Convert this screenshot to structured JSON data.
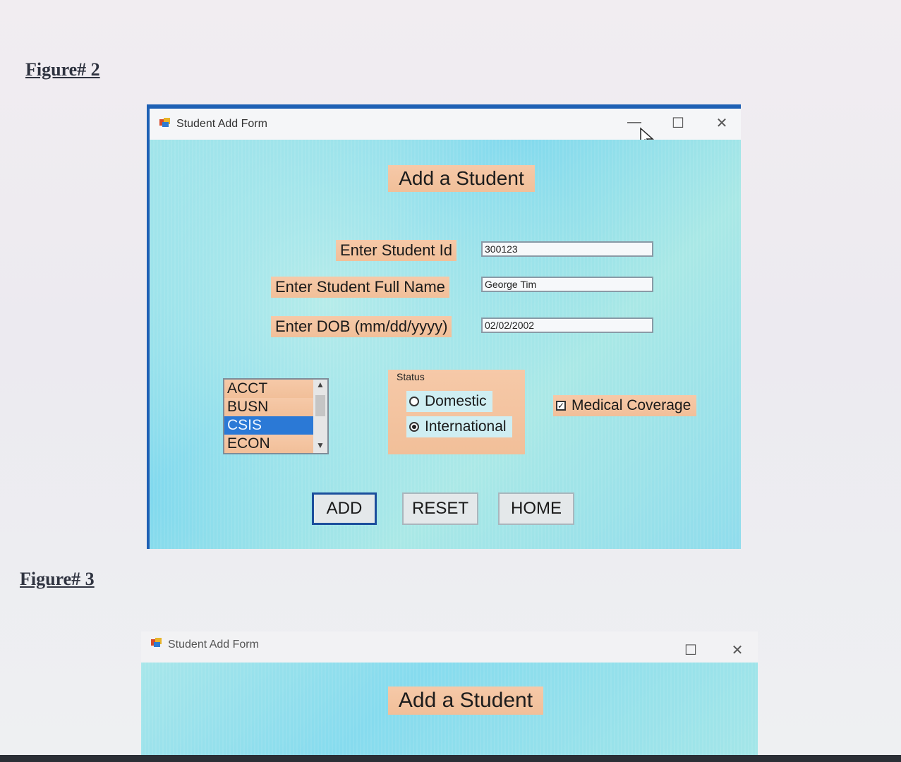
{
  "figures": {
    "fig2_label": "Figure# 2",
    "fig3_label": "Figure# 3"
  },
  "window": {
    "title": "Student Add Form",
    "controls": {
      "minimize": "—",
      "maximize": "☐",
      "close": "✕"
    }
  },
  "form": {
    "heading": "Add a Student",
    "student_id": {
      "label": "Enter Student Id",
      "value": "300123"
    },
    "full_name": {
      "label": "Enter Student Full Name",
      "value": "George Tim"
    },
    "dob": {
      "label": "Enter DOB (mm/dd/yyyy)",
      "value": "02/02/2002"
    },
    "departments": {
      "items": [
        "ACCT",
        "BUSN",
        "CSIS",
        "ECON"
      ],
      "selected": "CSIS"
    },
    "status": {
      "title": "Status",
      "options": [
        "Domestic",
        "International"
      ],
      "selected": "International"
    },
    "medical_coverage": {
      "label": "Medical Coverage",
      "checked": true
    },
    "buttons": {
      "add": "ADD",
      "reset": "RESET",
      "home": "HOME"
    }
  },
  "window2": {
    "title": "Student Add Form",
    "controls": {
      "maximize": "☐",
      "close": "✕"
    },
    "heading": "Add a Student"
  },
  "colors": {
    "accent_border": "#1e60b4",
    "form_background": "#8fdcec",
    "label_background": "#f1bf99",
    "selection": "#2b79d6"
  }
}
